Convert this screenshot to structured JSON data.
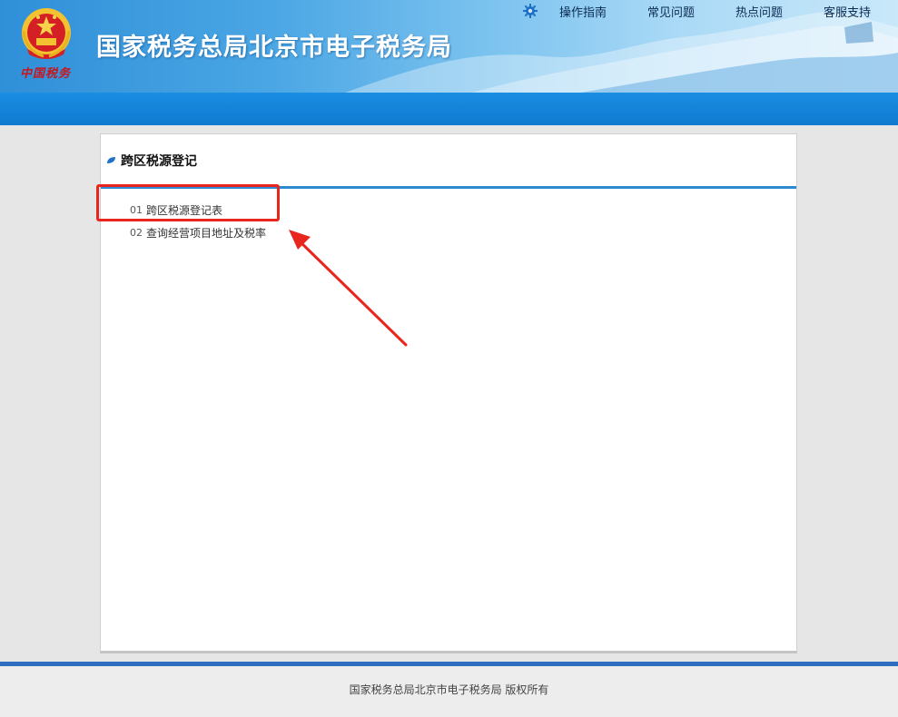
{
  "header": {
    "site_title": "国家税务总局北京市电子税务局",
    "seal_text": "中国税务",
    "nav": [
      {
        "label": "操作指南"
      },
      {
        "label": "常见问题"
      },
      {
        "label": "热点问题"
      },
      {
        "label": "客服支持"
      }
    ]
  },
  "card": {
    "title": "跨区税源登记",
    "items": [
      {
        "num": "01",
        "label": "跨区税源登记表"
      },
      {
        "num": "02",
        "label": "查询经营项目地址及税率"
      }
    ]
  },
  "footer": {
    "copyright": "国家税务总局北京市电子税务局  版权所有"
  },
  "colors": {
    "accent": "#2b8ad0",
    "header_bar": "#0f79d0",
    "annotation": "#e8261d"
  },
  "icons": {
    "gear": "gear-icon",
    "emblem": "national-emblem-icon",
    "leaf": "leaf-bullet-icon"
  }
}
